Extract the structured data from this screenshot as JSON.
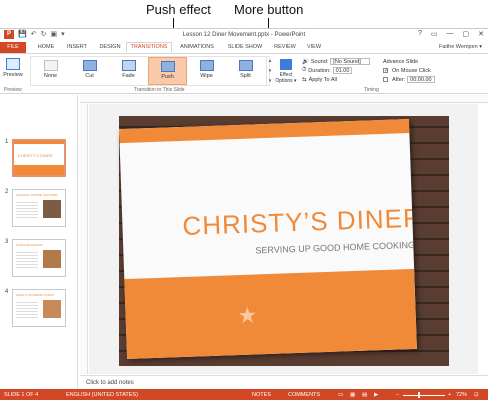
{
  "callouts": {
    "push_effect": "Push effect",
    "more_button": "More button"
  },
  "window": {
    "title": "Lesson 12 Diner Movement.pptx - PowerPoint",
    "controls": [
      "?",
      "▭",
      "—",
      "▢",
      "✕"
    ],
    "qat": [
      "💾",
      "↶",
      "↻",
      "▣",
      "▾"
    ]
  },
  "tabs": [
    "FILE",
    "HOME",
    "INSERT",
    "DESIGN",
    "TRANSITIONS",
    "ANIMATIONS",
    "SLIDE SHOW",
    "REVIEW",
    "VIEW"
  ],
  "active_tab": "TRANSITIONS",
  "user": "Faithe Wempen ▾",
  "ribbon": {
    "preview_label": "Preview",
    "group_preview": "Preview",
    "group_transition": "Transition to This Slide",
    "group_timing": "Timing",
    "gallery": [
      "None",
      "Cut",
      "Fade",
      "Push",
      "Wipe",
      "Split"
    ],
    "selected_transition": "Push",
    "effect_options": [
      "Effect",
      "Options ▾"
    ],
    "sound_label": "Sound:",
    "sound_value": "[No Sound]",
    "duration_label": "Duration:",
    "duration_value": "01.00",
    "apply_all": "Apply To All",
    "advance_label": "Advance Slide",
    "on_click": "On Mouse Click",
    "after_label": "After:",
    "after_value": "00:00.00"
  },
  "thumbnails": [
    {
      "num": "1",
      "title": "CHRISTY'S DINER"
    },
    {
      "num": "2",
      "title": "CHARLIE COFFEE COUNTER"
    },
    {
      "num": "3",
      "title": "OUR PHILOSOPHY"
    },
    {
      "num": "4",
      "title": "WHAT'S ON FRESH TODAY"
    }
  ],
  "slide": {
    "title": "CHRISTY’S DINER",
    "subtitle": "SERVING UP GOOD HOME COOKING"
  },
  "notes_placeholder": "Click to add notes",
  "status": {
    "slide": "SLIDE 1 OF 4",
    "language": "ENGLISH (UNITED STATES)",
    "notes": "NOTES",
    "comments": "COMMENTS",
    "zoom": "72%",
    "zoom_level": 0.72
  },
  "colors": {
    "accent": "#d24726",
    "theme_orange": "#f08a38",
    "selected": "#f9c9a9"
  }
}
